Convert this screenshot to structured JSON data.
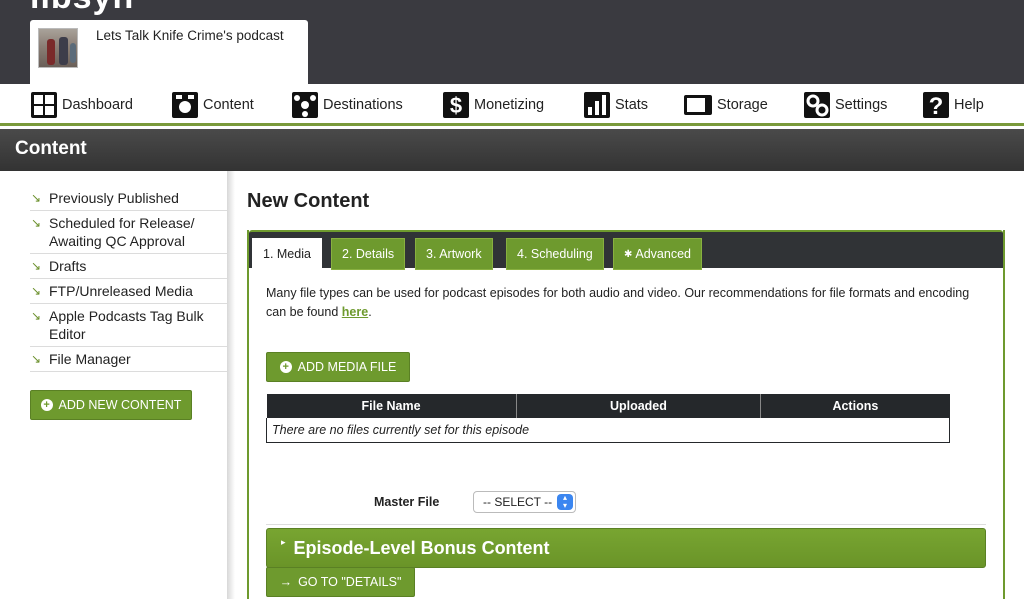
{
  "header": {
    "brand_fragment": "...",
    "podcast_title": "Lets Talk Knife Crime's podcast"
  },
  "nav": {
    "items": [
      {
        "label": "Dashboard",
        "icon": "dashboard-grid-icon"
      },
      {
        "label": "Content",
        "icon": "content-icon"
      },
      {
        "label": "Destinations",
        "icon": "destinations-icon"
      },
      {
        "label": "Monetizing",
        "icon": "dollar-icon"
      },
      {
        "label": "Stats",
        "icon": "bar-chart-icon"
      },
      {
        "label": "Storage",
        "icon": "storage-icon"
      },
      {
        "label": "Settings",
        "icon": "gears-icon"
      },
      {
        "label": "Help",
        "icon": "question-icon"
      }
    ]
  },
  "section": {
    "title": "Content"
  },
  "sidebar": {
    "items": [
      {
        "label": "Previously Published"
      },
      {
        "label": "Scheduled for Release/ Awaiting QC Approval"
      },
      {
        "label": "Drafts"
      },
      {
        "label": "FTP/Unreleased Media"
      },
      {
        "label": "Apple Podcasts Tag Bulk Editor"
      },
      {
        "label": "File Manager"
      }
    ],
    "add_button": "ADD NEW CONTENT"
  },
  "main": {
    "heading": "New Content",
    "tabs": [
      {
        "label": "1. Media",
        "active": true
      },
      {
        "label": "2. Details"
      },
      {
        "label": "3. Artwork"
      },
      {
        "label": "4. Scheduling"
      },
      {
        "label": "Advanced"
      }
    ],
    "info_text": "Many file types can be used for podcast episodes for both audio and video. Our recommendations for file formats and encoding can be found",
    "info_link": "here",
    "info_end": ".",
    "add_media_button": "ADD MEDIA FILE",
    "table": {
      "headers": [
        "File Name",
        "Uploaded",
        "Actions"
      ],
      "empty_message": "There are no files currently set for this episode"
    },
    "master_file_label": "Master File",
    "master_file_value": "-- SELECT --",
    "bonus_section": "Episode-Level Bonus Content",
    "goto_button": "GO TO \"DETAILS\""
  },
  "colors": {
    "accent_green": "#6e9a2e",
    "header_dark": "#3a3a40",
    "table_header": "#25282b"
  }
}
